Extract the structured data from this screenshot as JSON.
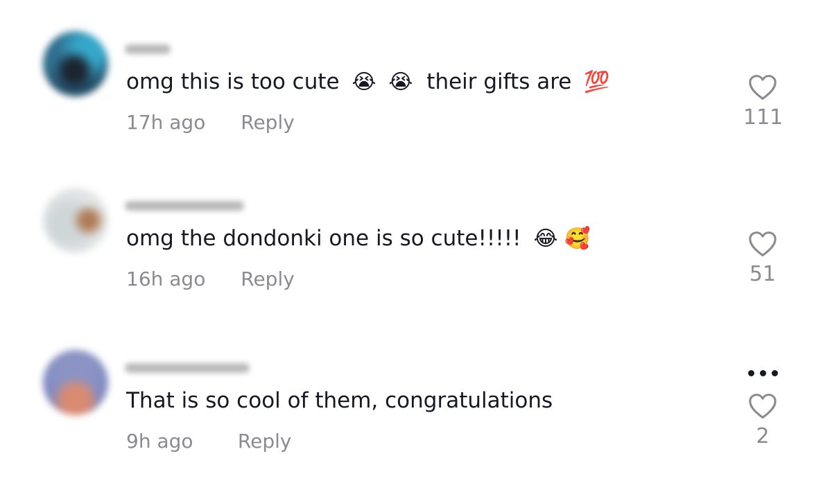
{
  "comments": [
    {
      "text": "omg this is too cute",
      "emojis_mid": [
        "😭",
        "😭"
      ],
      "text_after": "their gifts are",
      "emoji_end": "💯",
      "time": "17h ago",
      "reply_label": "Reply",
      "likes": "111"
    },
    {
      "text": "omg the dondonki one is so cute!!!!!",
      "emoji_end": "😂 🥰",
      "time": "16h ago",
      "reply_label": "Reply",
      "likes": "51"
    },
    {
      "text": "That is so cool of them, congratulations",
      "time": "9h ago",
      "reply_label": "Reply",
      "likes": "2",
      "more_icon": "ellipsis-icon"
    }
  ],
  "colors": {
    "primary_text": "#161823",
    "secondary_text": "#8a8b91",
    "heart_stroke": "#8a8b91"
  }
}
